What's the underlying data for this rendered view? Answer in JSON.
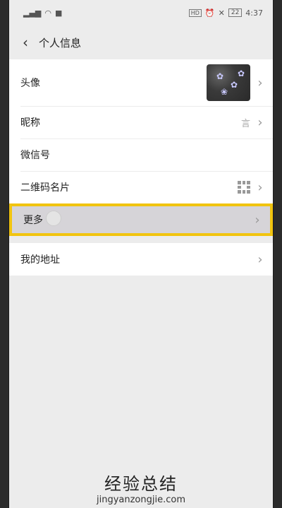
{
  "status": {
    "time": "4:37",
    "battery": "22",
    "hd": "HD"
  },
  "nav": {
    "title": "个人信息"
  },
  "rows": {
    "avatar_label": "头像",
    "nickname_label": "昵称",
    "nickname_value": "言",
    "wechat_id_label": "微信号",
    "qr_label": "二维码名片",
    "more_label": "更多",
    "address_label": "我的地址"
  },
  "watermark": {
    "text": "经验总结",
    "url": "jingyanzongjie.com"
  }
}
